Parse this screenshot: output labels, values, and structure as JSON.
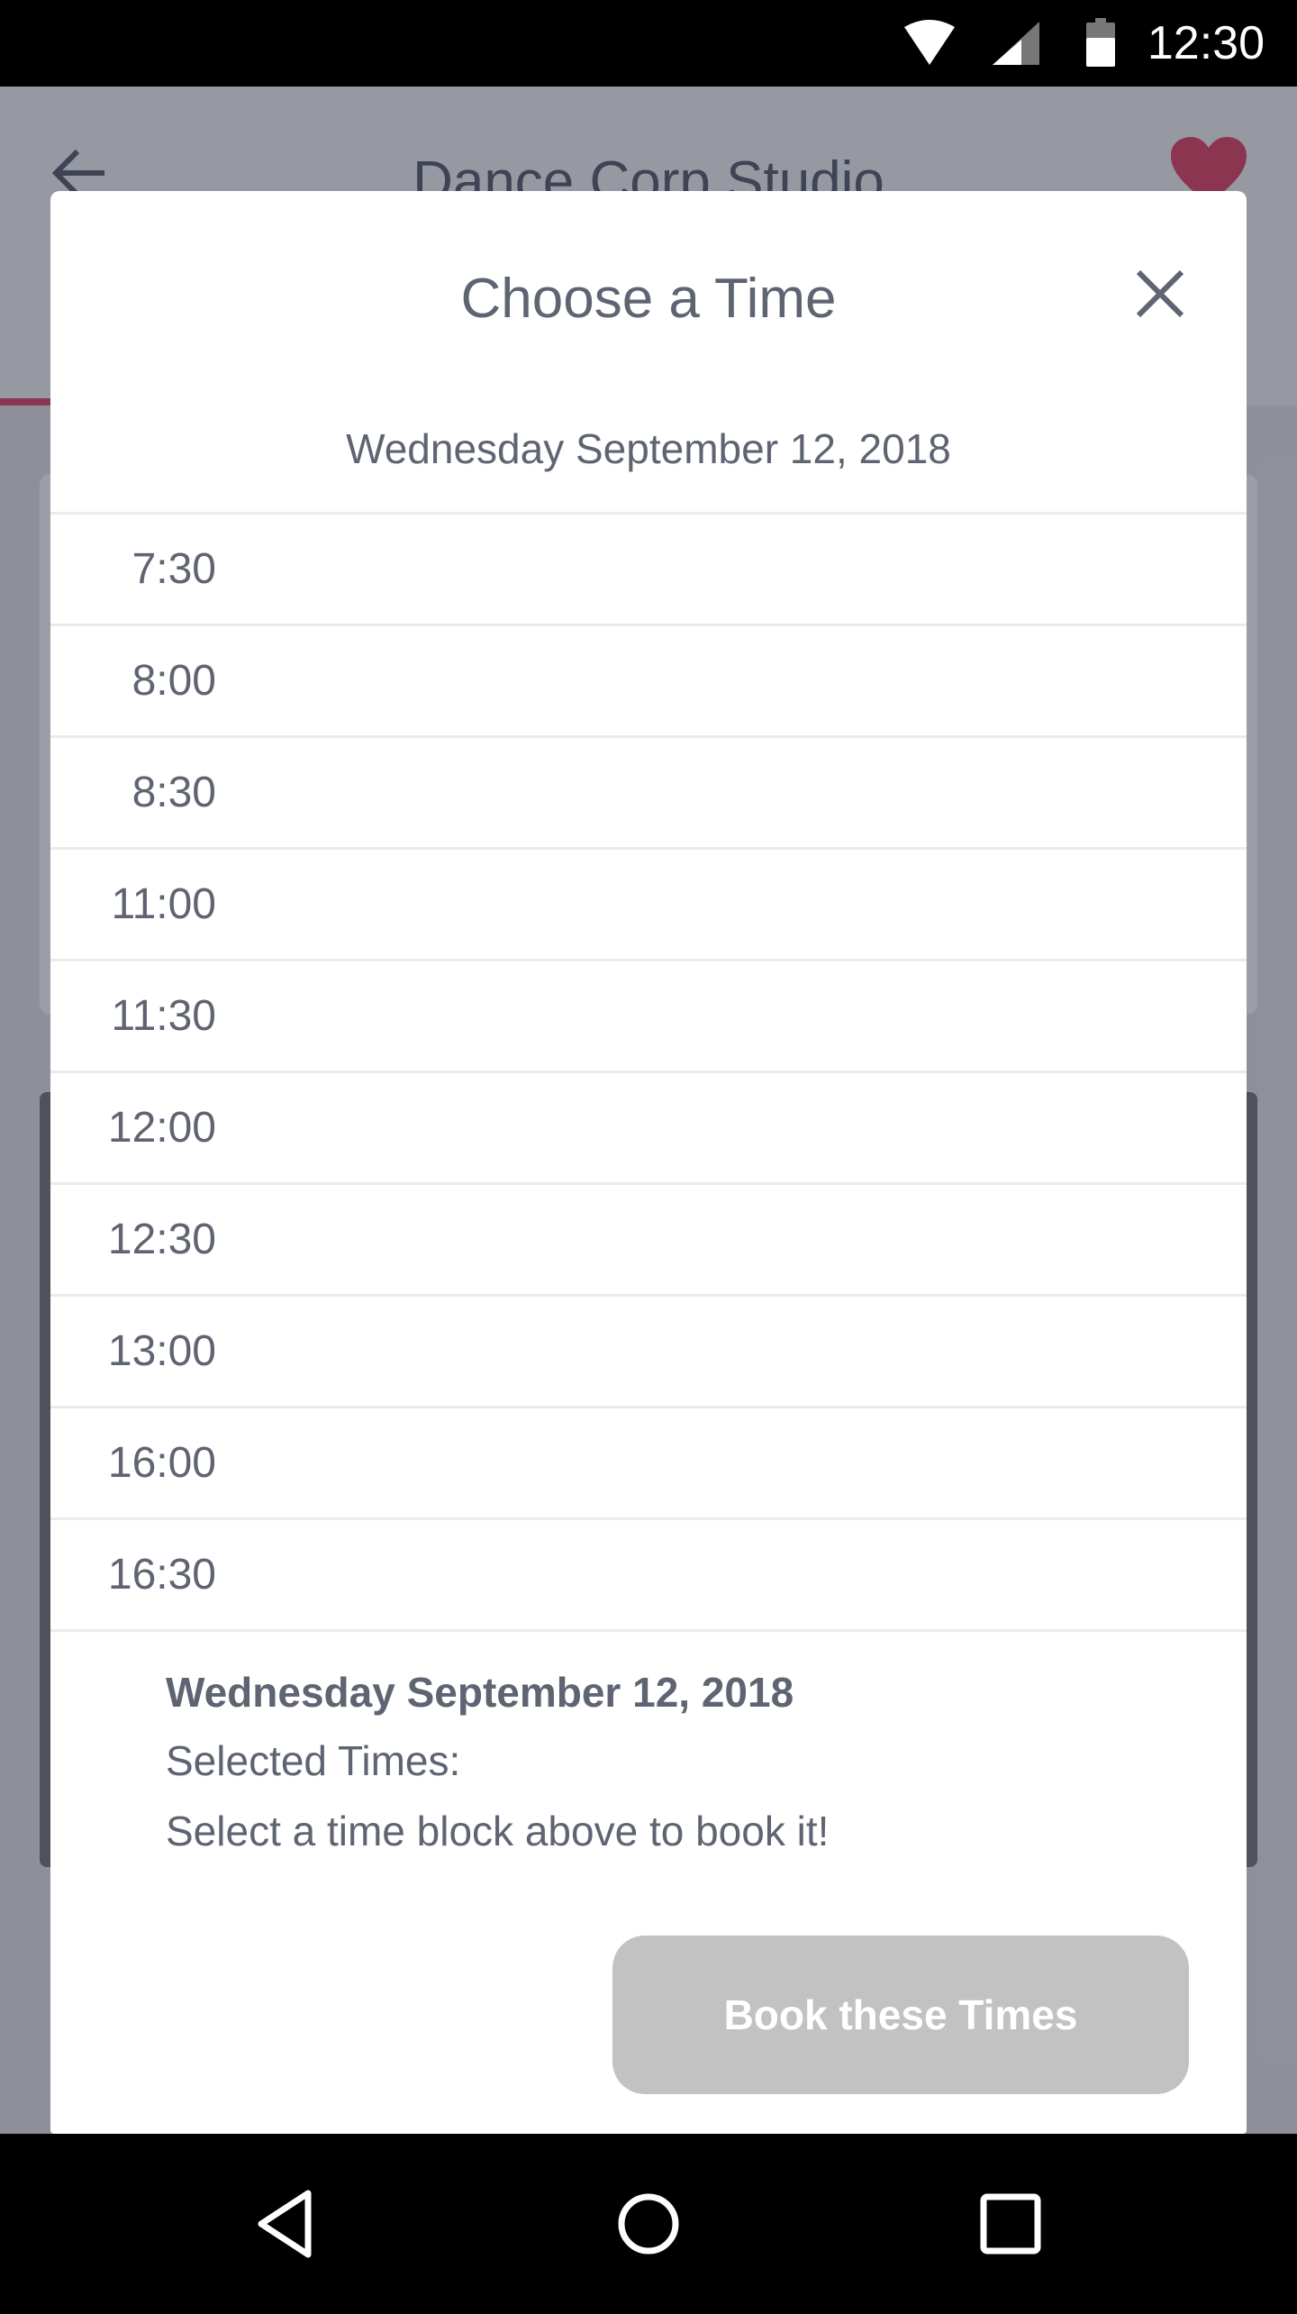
{
  "status_bar": {
    "time": "12:30"
  },
  "background": {
    "app_title": "Dance Corp Studio"
  },
  "modal": {
    "title": "Choose a Time",
    "date": "Wednesday September 12, 2018",
    "times": [
      "7:30",
      "8:00",
      "8:30",
      "11:00",
      "11:30",
      "12:00",
      "12:30",
      "13:00",
      "16:00",
      "16:30"
    ],
    "summary": {
      "date": "Wednesday September 12, 2018",
      "selected_label": "Selected Times:",
      "hint": "Select a time block above to book it!"
    },
    "book_button_label": "Book these Times"
  },
  "colors": {
    "accent": "#e24b6b",
    "text": "#5f6472",
    "button_disabled": "#c2c2c2"
  }
}
